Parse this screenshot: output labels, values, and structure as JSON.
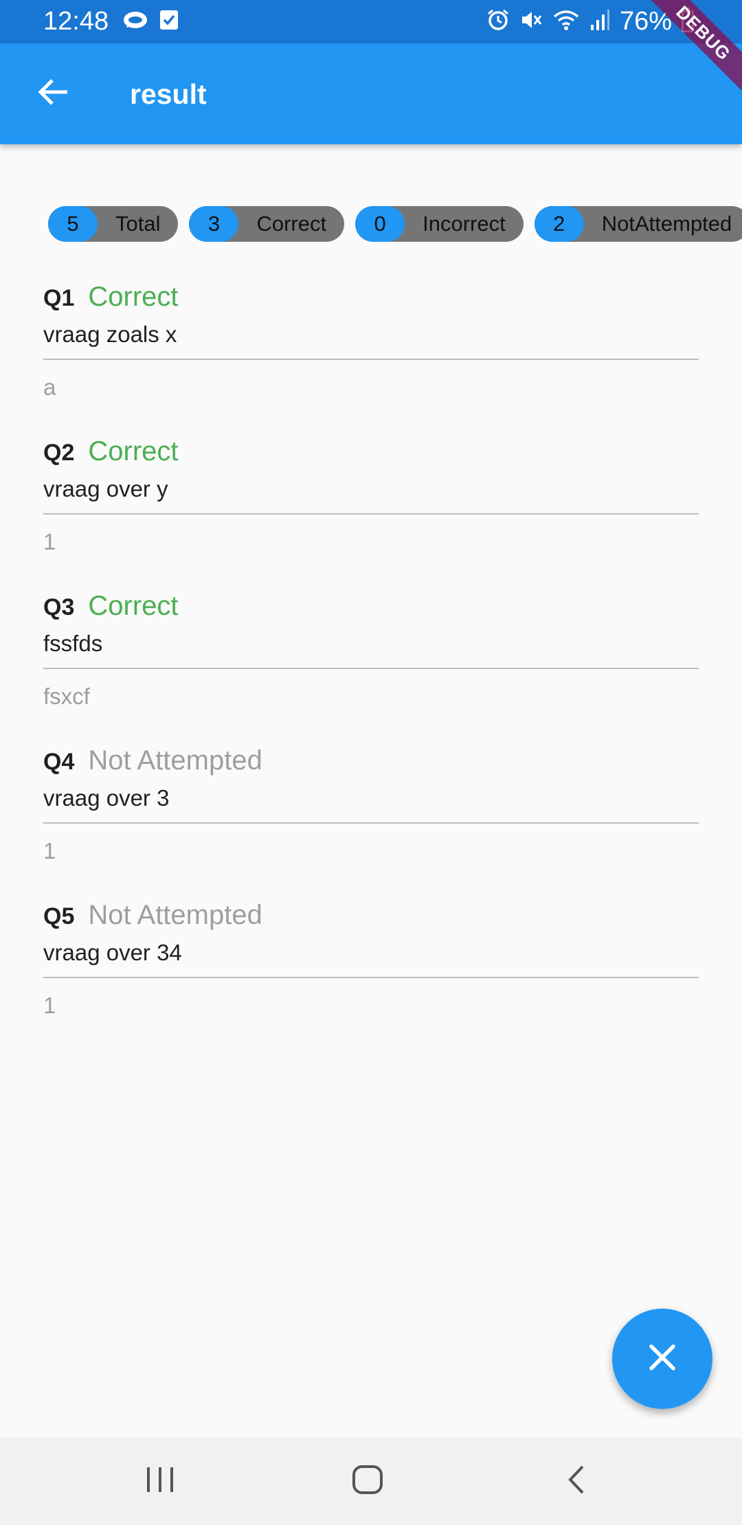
{
  "status_bar": {
    "time": "12:48",
    "battery": "76%",
    "icons": [
      "chat-bubble-icon",
      "checkbox-icon",
      "alarm-icon",
      "mute-icon",
      "wifi-icon",
      "signal-icon",
      "battery-charging-icon"
    ]
  },
  "app_bar": {
    "title": "result",
    "back_icon": "arrow-back-icon",
    "debug_label": "DEBUG"
  },
  "summary": [
    {
      "count": "5",
      "label": "Total"
    },
    {
      "count": "3",
      "label": "Correct"
    },
    {
      "count": "0",
      "label": "Incorrect"
    },
    {
      "count": "2",
      "label": "NotAttempted"
    }
  ],
  "questions": [
    {
      "number": "Q1",
      "status": "Correct",
      "question": "vraag zoals x",
      "answer": "a"
    },
    {
      "number": "Q2",
      "status": "Correct",
      "question": "vraag over y",
      "answer": "1"
    },
    {
      "number": "Q3",
      "status": "Correct",
      "question": "fssfds",
      "answer": "fsxcf"
    },
    {
      "number": "Q4",
      "status": "Not Attempted",
      "question": "vraag over 3",
      "answer": "1"
    },
    {
      "number": "Q5",
      "status": "Not Attempted",
      "question": "vraag over 34",
      "answer": "1"
    }
  ],
  "colors": {
    "status_bar": "#1976d2",
    "app_bar": "#2196f3",
    "correct": "#4caf50",
    "not_attempted": "#9e9e9e",
    "chip_count": "#2196f3",
    "chip_label": "#757575"
  },
  "fab": {
    "icon": "close-icon"
  },
  "nav_bar": {
    "icons": [
      "recent-apps-icon",
      "home-icon",
      "back-nav-icon"
    ]
  }
}
